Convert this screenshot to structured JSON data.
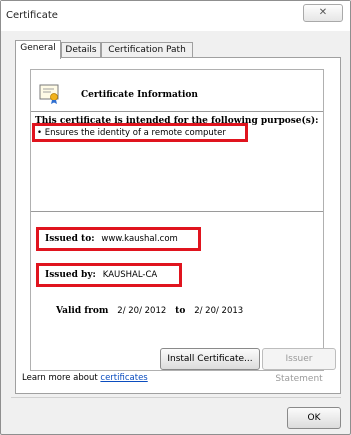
{
  "window": {
    "title": "Certificate",
    "close_glyph": "✕"
  },
  "tabs": [
    {
      "label": "General"
    },
    {
      "label": "Details"
    },
    {
      "label": "Certification Path"
    }
  ],
  "cert": {
    "header_title": "Certificate Information",
    "purpose_heading": "This certificate is intended for the following purpose(s):",
    "purpose_items": [
      "• Ensures the identity of a remote computer"
    ],
    "issued_to_label": "Issued to:",
    "issued_to_value": "www.kaushal.com",
    "issued_by_label": "Issued by:",
    "issued_by_value": "KAUSHAL-CA",
    "valid_from_label": "Valid from",
    "valid_from_value": "2/ 20/ 2012",
    "valid_to_label": "to",
    "valid_to_value": "2/ 20/ 2013"
  },
  "buttons": {
    "install": "Install Certificate...",
    "issuer_statement": "Issuer Statement",
    "ok": "OK"
  },
  "footer": {
    "learn_prefix": "Learn more about ",
    "learn_link": "certificates"
  },
  "colors": {
    "highlight": "#e0141e",
    "link": "#0b4dbf"
  }
}
